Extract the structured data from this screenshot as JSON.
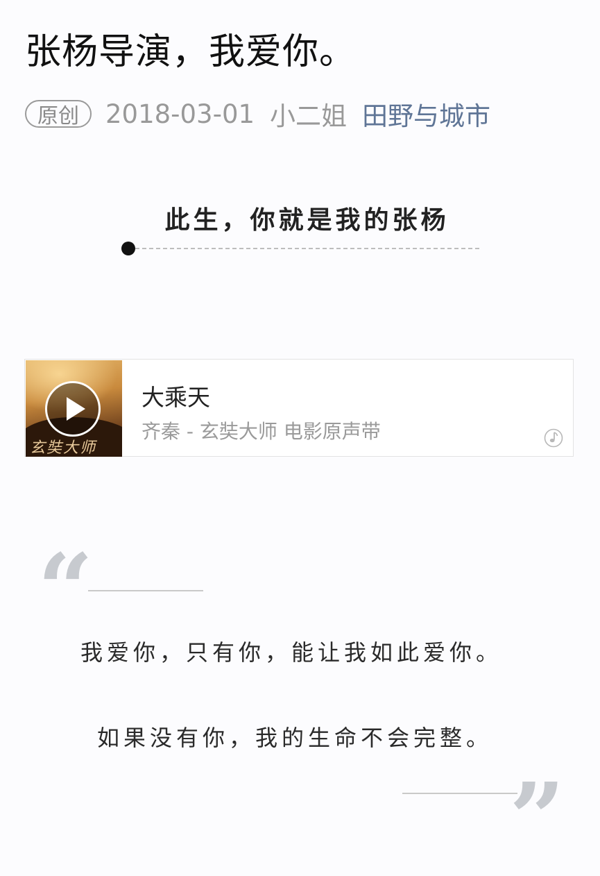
{
  "article": {
    "title": "张杨导演，我爱你。",
    "badge": "原创",
    "date": "2018-03-01",
    "author": "小二姐",
    "account": "田野与城市"
  },
  "section": {
    "heading": "此生，你就是我的张杨"
  },
  "music": {
    "title": "大乘天",
    "subtitle": "齐秦 - 玄奘大师 电影原声带",
    "cover_text": "玄奘大师",
    "play_icon": "play-icon",
    "logo_icon": "music-note-logo-icon"
  },
  "quote": {
    "open_mark": "“",
    "close_mark": "”",
    "lines": [
      "我爱你，只有你，能让我如此爱你。",
      "如果没有你，我的生命不会完整。"
    ]
  },
  "colors": {
    "background": "#fcfcfe",
    "title": "#111111",
    "meta_gray": "#999999",
    "account_link": "#5f7596",
    "quote_mark": "#c7cacf"
  }
}
